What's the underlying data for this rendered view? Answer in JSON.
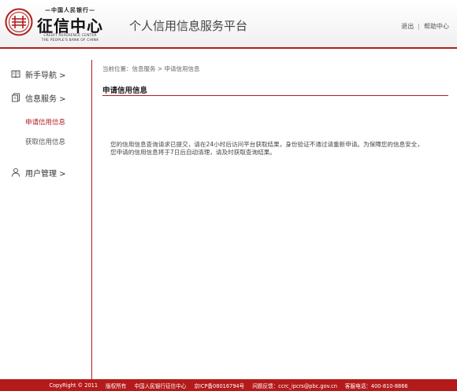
{
  "header": {
    "logo": {
      "top_text": "—中国人民银行—",
      "title": "征信中心",
      "en_line1": "CREDIT REFERENCE CENTER",
      "en_line2": "THE PEOPLE'S BANK OF CHINA"
    },
    "platform_title": "个人信用信息服务平台",
    "links": {
      "logout": "退出",
      "help": "帮助中心"
    },
    "brand_color": "#b01e1e"
  },
  "sidebar": {
    "items": [
      {
        "label": "新手导航 >",
        "icon": "book-icon"
      },
      {
        "label": "信息服务 >",
        "icon": "document-icon"
      },
      {
        "label": "用户管理 >",
        "icon": "user-icon"
      }
    ],
    "subitems": [
      {
        "label": "申请信用信息",
        "active": true
      },
      {
        "label": "获取信用信息",
        "active": false
      }
    ]
  },
  "main": {
    "breadcrumb": "当前位置：信息服务 > 申请信用信息",
    "section_title": "申请信用信息",
    "message_line1": "您的信用信息查询请求已提交，请在24小时后访问平台获取结果，身份验证不通过请重新申请。为保障您的信息安全，",
    "message_line2": "您申请的信用信息将于7日后自动清理，请及时获取查询结果。"
  },
  "footer": {
    "copyright": "CopyRight © 2011",
    "rights": "版权所有",
    "org": "中国人民银行征信中心",
    "icp": "京ICP备08016794号",
    "feedback": "问题反馈：ccrc_ipcrs@pbc.gov.cn",
    "hotline": "客服电话：400-810-8866"
  }
}
